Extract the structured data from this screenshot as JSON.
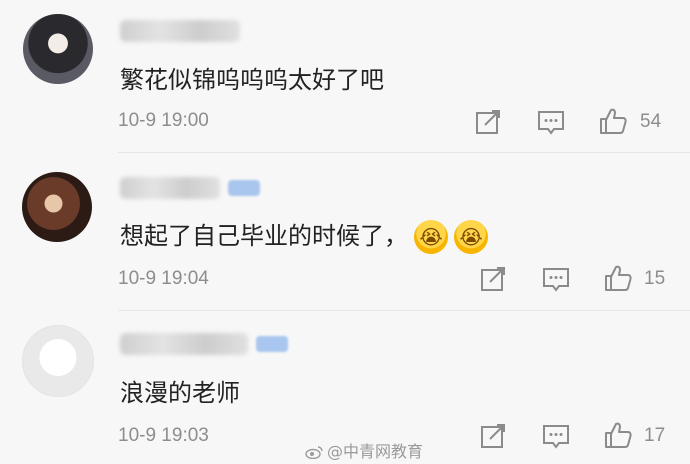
{
  "comments": [
    {
      "text": "繁花似锦呜呜呜太好了吧",
      "time": "10-9 19:00",
      "likes": "54"
    },
    {
      "text": "想起了自己毕业的时候了，",
      "time": "10-9 19:04",
      "likes": "15",
      "emojis": [
        "crying-face-icon",
        "crying-face-icon"
      ]
    },
    {
      "text": "浪漫的老师",
      "time": "10-9 19:03",
      "likes": "17"
    }
  ],
  "watermark": "@中青网教育",
  "colors": {
    "text": "#222222",
    "meta": "#8d8d8d",
    "background": "#f7f7f7",
    "badge": "#a9c6ef"
  },
  "icons": [
    "share-icon",
    "comment-icon",
    "like-icon"
  ]
}
